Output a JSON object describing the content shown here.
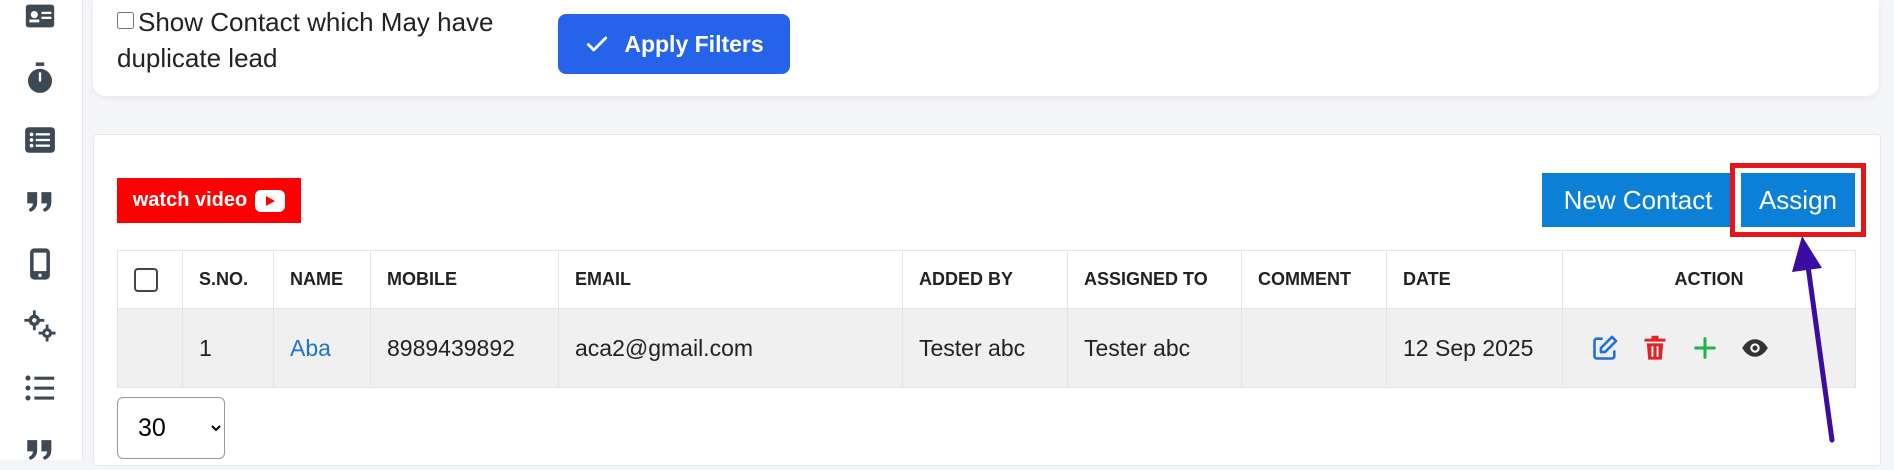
{
  "sidebar": {
    "icons": [
      "contact-card-icon",
      "stopwatch-icon",
      "list-box-icon",
      "quote-icon",
      "mobile-icon",
      "gears-icon",
      "bullet-list-icon",
      "quote-icon-partial"
    ]
  },
  "filters": {
    "duplicate_label": "Show Contact which May have duplicate lead",
    "apply_label": "Apply Filters"
  },
  "toolbar": {
    "watch_video_label": "watch video",
    "new_contact_label": "New Contact",
    "assign_label": "Assign"
  },
  "table": {
    "headers": [
      "S.NO.",
      "NAME",
      "MOBILE",
      "EMAIL",
      "ADDED BY",
      "ASSIGNED TO",
      "COMMENT",
      "DATE",
      "ACTION"
    ],
    "rows": [
      {
        "sno": "1",
        "name": "Aba",
        "mobile": "8989439892",
        "email": "aca2@gmail.com",
        "added_by": "Tester abc",
        "assigned_to": "Tester abc",
        "comment": "",
        "date": "12 Sep 2025"
      }
    ]
  },
  "pagination": {
    "per_page": "30"
  },
  "colors": {
    "primary": "#2563eb",
    "accent": "#0c7fd6",
    "highlight": "#e4161a",
    "arrow": "#3a0ca3",
    "youtube": "#ff0000"
  }
}
